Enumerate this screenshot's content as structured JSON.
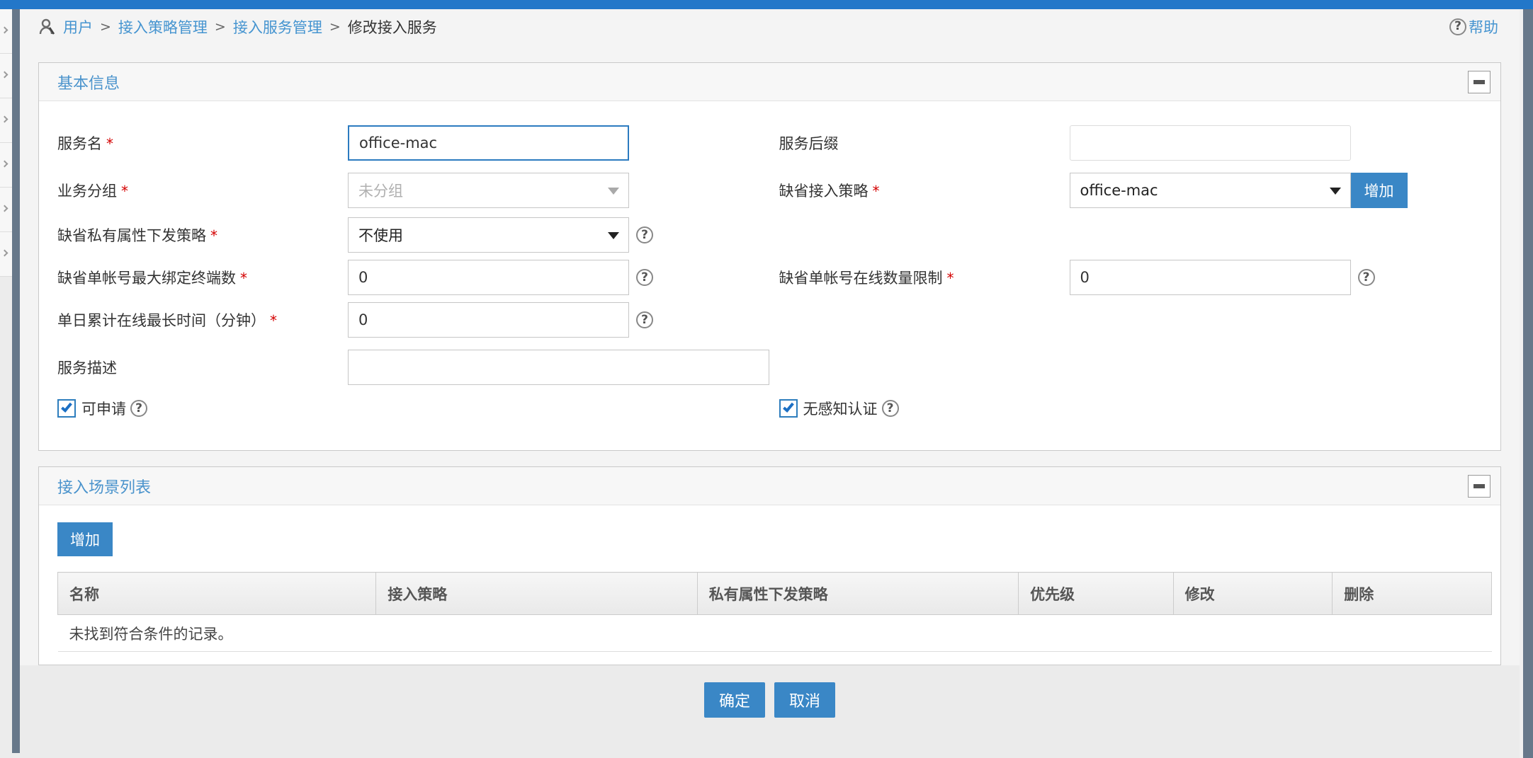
{
  "icons": {
    "question": "?"
  },
  "required_mark": "*",
  "colors": {
    "topbar": "#2377c9",
    "accent_button": "#3a87c6",
    "link": "#4594d0",
    "panel_title": "#4a93cc",
    "focus_border": "#2c7bc0",
    "rail": "#67788a"
  },
  "breadcrumb": {
    "separator": ">",
    "items": [
      "用户",
      "接入策略管理",
      "接入服务管理",
      "修改接入服务"
    ],
    "help_label": "帮助"
  },
  "panel_basic": {
    "title": "基本信息",
    "fields": {
      "service_name": {
        "label": "服务名",
        "value": "office-mac"
      },
      "service_suffix": {
        "label": "服务后缀",
        "value": ""
      },
      "service_group": {
        "label": "业务分组",
        "value": "未分组"
      },
      "default_policy": {
        "label": "缺省接入策略",
        "value": "office-mac",
        "add_button": "增加"
      },
      "private_attr_policy": {
        "label": "缺省私有属性下发策略",
        "value": "不使用"
      },
      "max_bind_terminals": {
        "label": "缺省单帐号最大绑定终端数",
        "value": "0"
      },
      "online_limit": {
        "label": "缺省单帐号在线数量限制",
        "value": "0"
      },
      "daily_online_max": {
        "label": "单日累计在线最长时间（分钟）",
        "value": "0"
      },
      "service_desc": {
        "label": "服务描述",
        "value": ""
      },
      "can_apply": {
        "label": "可申请",
        "checked": true
      },
      "mac_fast_auth": {
        "label": "无感知认证",
        "checked": true
      }
    }
  },
  "panel_scene": {
    "title": "接入场景列表",
    "add_button": "增加",
    "table": {
      "columns": [
        "名称",
        "接入策略",
        "私有属性下发策略",
        "优先级",
        "修改",
        "删除"
      ],
      "empty_text": "未找到符合条件的记录。"
    }
  },
  "footer": {
    "ok_label": "确定",
    "cancel_label": "取消"
  }
}
